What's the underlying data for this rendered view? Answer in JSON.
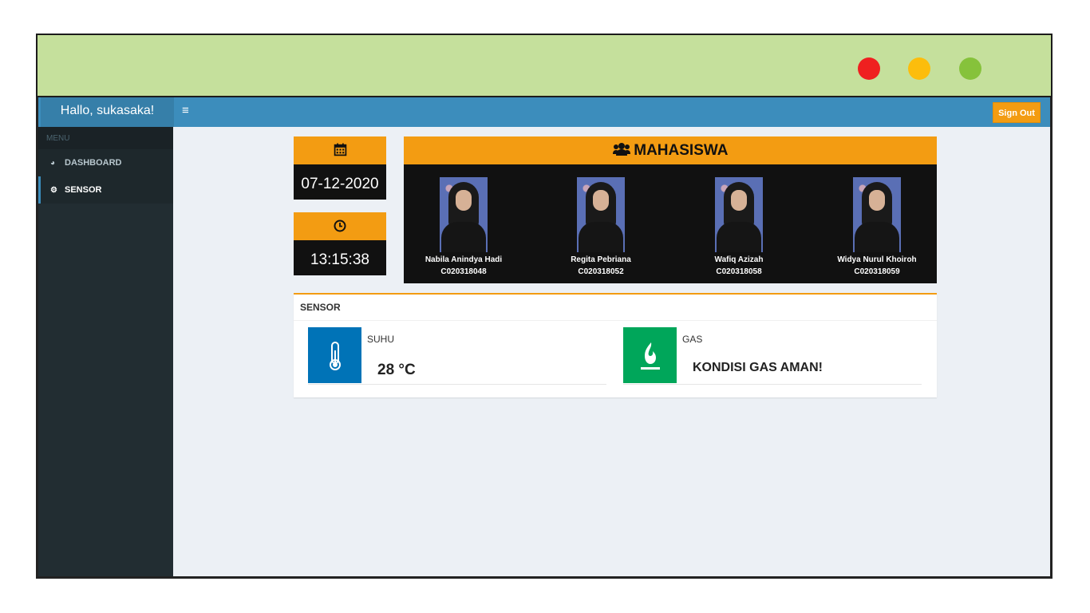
{
  "window": {
    "controls": {
      "close_color": "#ef2020",
      "minimize_color": "#fcbd0c",
      "maximize_color": "#86c23b"
    }
  },
  "navbar": {
    "greeting": "Hallo, sukasaka!",
    "toggle_icon": "≡",
    "sign_out_label": "Sign Out",
    "accent": "#3c8dbc"
  },
  "sidebar": {
    "header": "MENU",
    "items": [
      {
        "label": "DASHBOARD",
        "icon": "dashboard-icon",
        "active": false
      },
      {
        "label": "SENSOR",
        "icon": "gears-icon",
        "active": true
      }
    ]
  },
  "date_box": {
    "icon": "calendar-icon",
    "value": "07-12-2020"
  },
  "time_box": {
    "icon": "clock-icon",
    "value": "13:15:38"
  },
  "mahasiswa": {
    "title": "MAHASISWA",
    "icon": "users-icon",
    "students": [
      {
        "name": "Nabila Anindya Hadi",
        "nim": "C020318048"
      },
      {
        "name": "Regita Pebriana",
        "nim": "C020318052"
      },
      {
        "name": "Wafiq Azizah",
        "nim": "C020318058"
      },
      {
        "name": "Widya Nurul Khoiroh",
        "nim": "C020318059"
      }
    ]
  },
  "sensor": {
    "title": "SENSOR",
    "suhu": {
      "label": "SUHU",
      "value": "28 °C",
      "icon": "thermometer-icon",
      "color": "#0073b7"
    },
    "gas": {
      "label": "GAS",
      "value": "KONDISI GAS AMAN!",
      "icon": "fire-icon",
      "color": "#00a65a"
    }
  }
}
